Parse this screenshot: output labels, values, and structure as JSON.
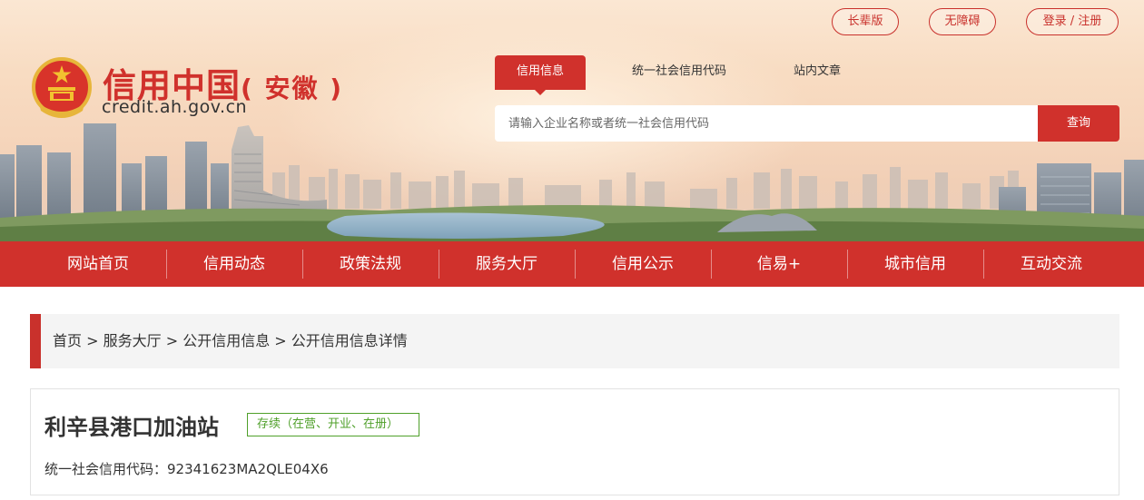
{
  "header": {
    "top_buttons": [
      "长辈版",
      "无障碍",
      "登录 / 注册"
    ],
    "site_title": "信用中国",
    "province": "( 安徽 )",
    "site_url": "credit.ah.gov.cn",
    "search_tabs": [
      "信用信息",
      "统一社会信用代码",
      "站内文章"
    ],
    "search_placeholder": "请输入企业名称或者统一社会信用代码",
    "search_button": "查询"
  },
  "nav": [
    "网站首页",
    "信用动态",
    "政策法规",
    "服务大厅",
    "信用公示",
    "信易+",
    "城市信用",
    "互动交流"
  ],
  "breadcrumb": [
    "首页",
    " > ",
    "服务大厅",
    " > ",
    "公开信用信息",
    " > ",
    "公开信用信息详情"
  ],
  "detail": {
    "company_name": "利辛县港口加油站",
    "status": "存续（在营、开业、在册）",
    "credit_code": "统一社会信用代码：92341623MA2QLE04X6"
  },
  "colors": {
    "brand_red": "#d0312c",
    "status_green": "#4fa02a"
  }
}
